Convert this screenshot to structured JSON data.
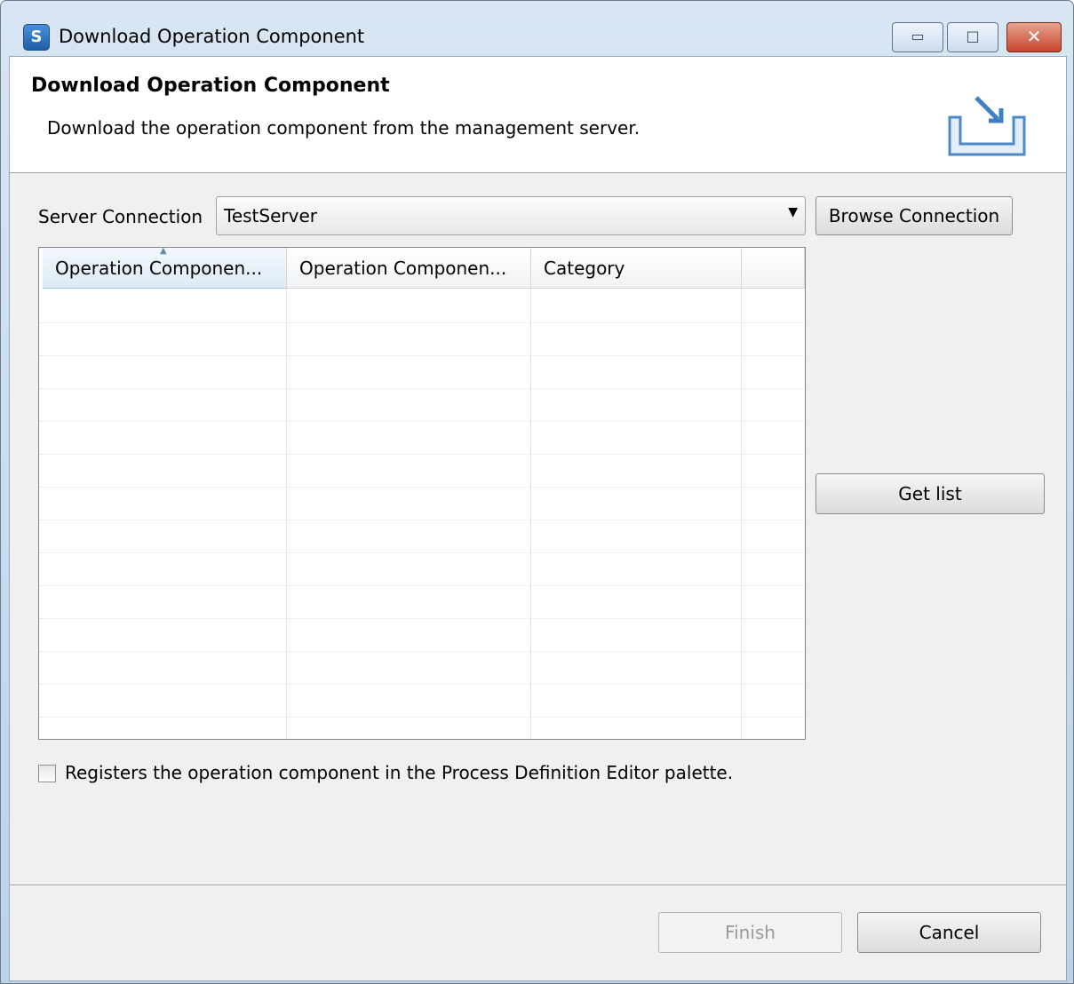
{
  "window": {
    "title": "Download Operation Component",
    "minimize_glyph": "▭",
    "maximize_glyph": "□",
    "close_glyph": "✕"
  },
  "banner": {
    "title": "Download Operation Component",
    "description": "Download the operation component from the management server.",
    "icon": "download-tray-icon"
  },
  "server": {
    "label": "Server Connection",
    "selected": "TestServer",
    "browse_label": "Browse Connection"
  },
  "table": {
    "columns": [
      "Operation Componen...",
      "Operation Componen...",
      "Category",
      ""
    ],
    "rows": []
  },
  "get_list_label": "Get list",
  "register_label": "Registers the operation component in the Process Definition Editor palette.",
  "register_checked": false,
  "footer": {
    "finish_label": "Finish",
    "cancel_label": "Cancel"
  },
  "colors": {
    "title_bar": "#d8e6f3",
    "close_button": "#c6452d",
    "dialog_bg": "#f0f0f0"
  }
}
